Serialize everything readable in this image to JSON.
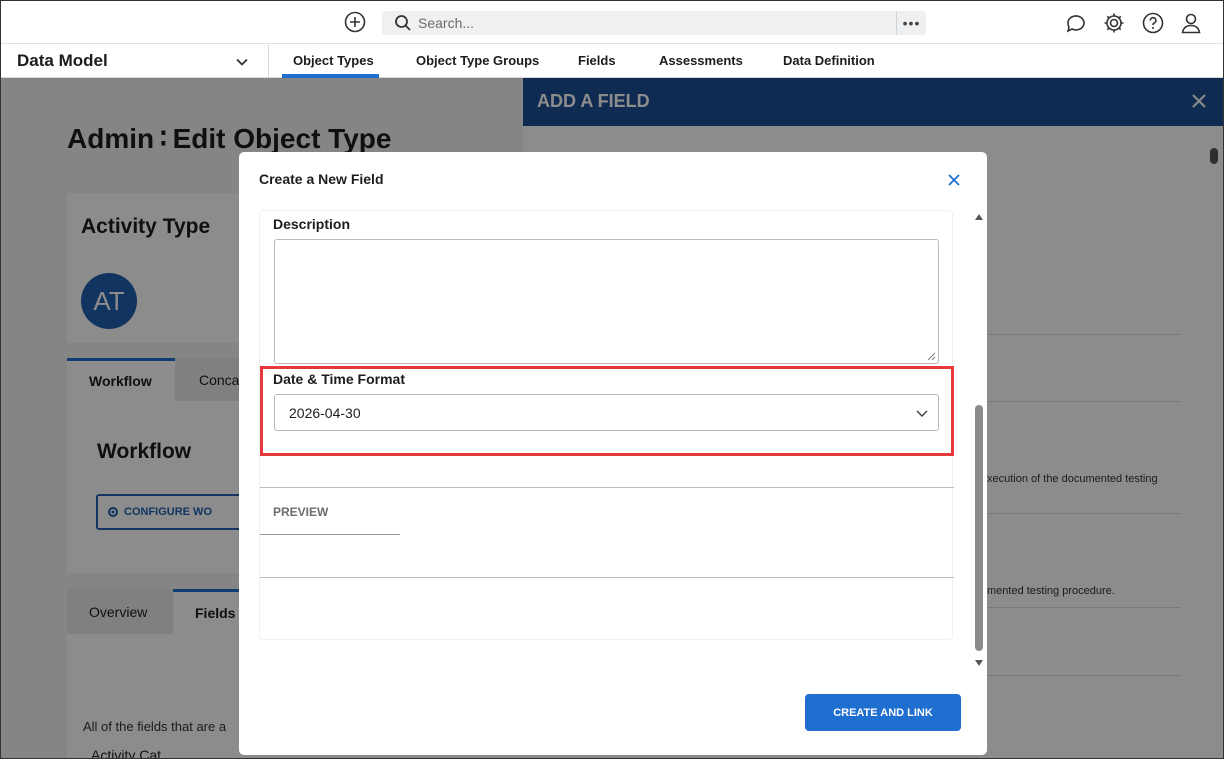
{
  "topbar": {
    "search_placeholder": "Search...",
    "more_label": "•••",
    "icons": [
      "add-circle-icon",
      "search-icon",
      "chat-icon",
      "gear-icon",
      "help-icon",
      "user-icon"
    ]
  },
  "nav": {
    "app_name": "Data Model",
    "tabs": [
      {
        "label": "Object Types",
        "active": true
      },
      {
        "label": "Object Type Groups"
      },
      {
        "label": "Fields"
      },
      {
        "label": "Assessments"
      },
      {
        "label": "Data Definition"
      }
    ]
  },
  "page": {
    "title": "Admin ∶ Edit Object Type",
    "card_title": "Activity Type",
    "avatar_initials": "AT",
    "section_tabs": [
      {
        "label": "Workflow"
      },
      {
        "label": "Conca"
      }
    ],
    "workflow_heading": "Workflow",
    "configure_button": "CONFIGURE WO",
    "lower_tabs": [
      {
        "label": "Overview"
      },
      {
        "label": "Fields"
      }
    ],
    "fields_note": "All of the fields that are a",
    "fields_sub": "Activity Cat"
  },
  "side_panel": {
    "title": "ADD A FIELD",
    "text_1": "xecution of the documented testing",
    "text_2": "mented testing procedure."
  },
  "modal": {
    "title": "Create a New Field",
    "description_label": "Description",
    "description_value": "",
    "date_time_label": "Date & Time Format",
    "date_time_value": "2026-04-30",
    "preview_label": "PREVIEW",
    "create_button": "CREATE AND LINK"
  },
  "colors": {
    "accent": "#1f6fd1",
    "panel_header": "#1e4f95",
    "highlight": "#e5393c"
  }
}
